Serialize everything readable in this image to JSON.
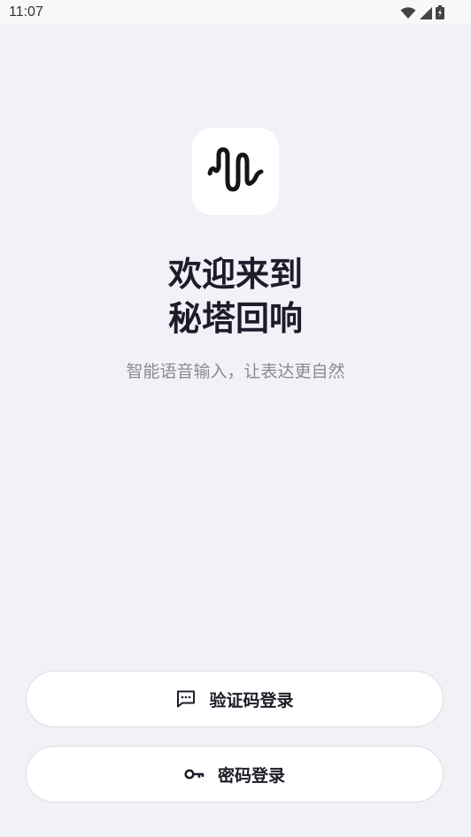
{
  "status_bar": {
    "time": "11:07",
    "icons": [
      "wifi-icon",
      "signal-icon",
      "battery-icon"
    ]
  },
  "logo": {
    "icon": "waveform-icon"
  },
  "welcome": {
    "line1": "欢迎来到",
    "line2": "秘塔回响",
    "tagline": "智能语音输入，让表达更自然"
  },
  "buttons": {
    "sms_login": {
      "label": "验证码登录",
      "icon": "message-icon"
    },
    "password_login": {
      "label": "密码登录",
      "icon": "key-icon"
    }
  },
  "colors": {
    "background": "#f2f1f7",
    "button_bg": "#ffffff",
    "text_primary": "#1c1c28",
    "text_secondary": "#8b8b93"
  }
}
